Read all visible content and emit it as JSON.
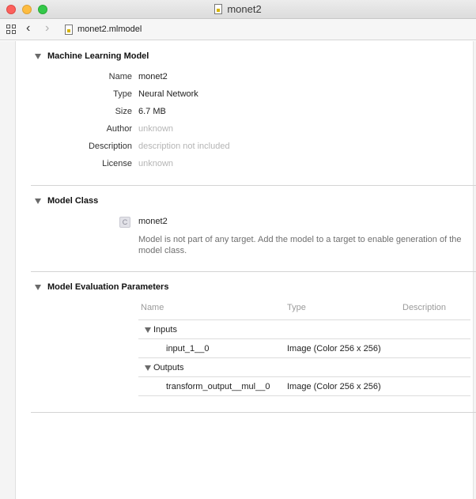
{
  "window": {
    "title": "monet2"
  },
  "jumpbar": {
    "file": "monet2.mlmodel"
  },
  "ml_model": {
    "heading": "Machine Learning Model",
    "properties": [
      {
        "label": "Name",
        "value": "monet2",
        "muted": false
      },
      {
        "label": "Type",
        "value": "Neural Network",
        "muted": false
      },
      {
        "label": "Size",
        "value": "6.7 MB",
        "muted": false
      },
      {
        "label": "Author",
        "value": "unknown",
        "muted": true
      },
      {
        "label": "Description",
        "value": "description not included",
        "muted": true
      },
      {
        "label": "License",
        "value": "unknown",
        "muted": true
      }
    ]
  },
  "model_class": {
    "heading": "Model Class",
    "badge": "C",
    "name": "monet2",
    "note": "Model is not part of any target. Add the model to a target to enable generation of the model class."
  },
  "eval_params": {
    "heading": "Model Evaluation Parameters",
    "columns": [
      "Name",
      "Type",
      "Description"
    ],
    "groups": [
      {
        "label": "Inputs",
        "rows": [
          {
            "name": "input_1__0",
            "type": "Image (Color 256 x 256)"
          }
        ]
      },
      {
        "label": "Outputs",
        "rows": [
          {
            "name": "transform_output__mul__0",
            "type": "Image (Color 256 x 256)"
          }
        ]
      }
    ]
  },
  "icons": [
    "close-dot",
    "minimize-dot",
    "zoom-dot",
    "file-icon",
    "grid-icon",
    "back-icon",
    "forward-icon",
    "disclosure-triangle-icon",
    "class-badge-icon"
  ]
}
